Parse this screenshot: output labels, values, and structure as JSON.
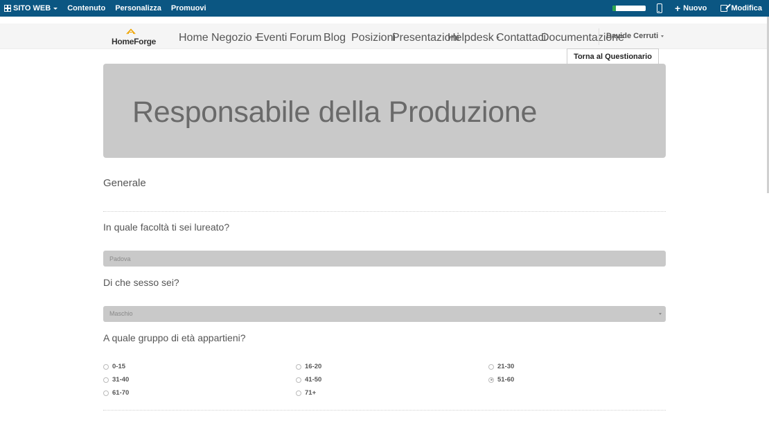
{
  "adminbar": {
    "site_label": "SITO WEB",
    "menu": [
      "Contenuto",
      "Personalizza",
      "Promuovi"
    ],
    "progress_fraction": 0.1,
    "new_label": "Nuovo",
    "edit_label": "Modifica"
  },
  "navbar": {
    "brand": "HomeForge",
    "items": [
      {
        "label": "Home",
        "dropdown": false
      },
      {
        "label": "Negozio",
        "dropdown": true
      },
      {
        "label": "Eventi",
        "dropdown": false
      },
      {
        "label": "Forum",
        "dropdown": false
      },
      {
        "label": "Blog",
        "dropdown": false
      },
      {
        "label": "Posizioni",
        "dropdown": false
      },
      {
        "label": "Presentazioni",
        "dropdown": false
      },
      {
        "label": "Helpdesk",
        "dropdown": true
      },
      {
        "label": "Contattaci",
        "dropdown": false
      },
      {
        "label": "Documentazione",
        "dropdown": false
      }
    ],
    "user": "Davide Cerruti"
  },
  "back_button": "Torna al Questionario",
  "hero_title": "Responsabile della Produzione",
  "section_title": "Generale",
  "questions": {
    "faculty": {
      "label": "In quale facoltà ti sei lureato?",
      "value": "Padova"
    },
    "sex": {
      "label": "Di che sesso sei?",
      "selected": "Maschio"
    },
    "age": {
      "label": "A quale gruppo di età appartieni?",
      "options": [
        "0-15",
        "16-20",
        "21-30",
        "31-40",
        "41-50",
        "51-60",
        "61-70",
        "71+"
      ],
      "selected": "51-60"
    }
  },
  "colors": {
    "adminbar_bg": "#0b5682",
    "hero_bg": "#c9c9c9",
    "logo_accent": "#f0a500"
  }
}
